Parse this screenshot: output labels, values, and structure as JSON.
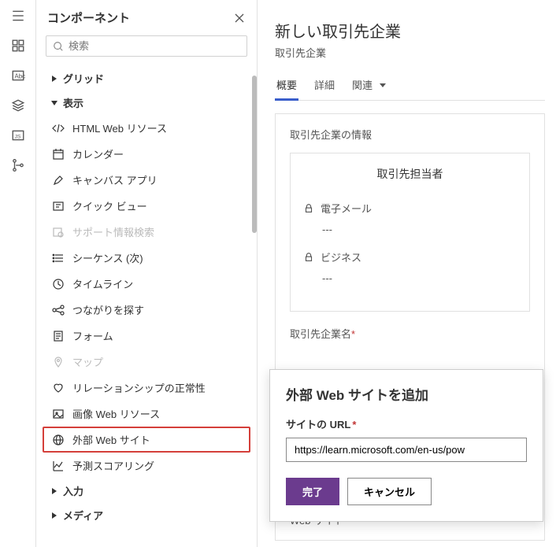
{
  "panel": {
    "title": "コンポーネント",
    "search_placeholder": "検索",
    "sections": {
      "grid": "グリッド",
      "display": "表示",
      "input": "入力",
      "media": "メディア"
    },
    "items": {
      "html_web": "HTML Web リソース",
      "calendar": "カレンダー",
      "canvas": "キャンバス アプリ",
      "quick_view": "クイック ビュー",
      "support": "サポート情報検索",
      "sequence": "シーケンス (次)",
      "timeline": "タイムライン",
      "connections": "つながりを探す",
      "form": "フォーム",
      "map": "マップ",
      "relationship": "リレーションシップの正常性",
      "image_web": "画像 Web リソース",
      "external_web": "外部 Web サイト",
      "predictive": "予測スコアリング"
    }
  },
  "main": {
    "title": "新しい取引先企業",
    "subtitle": "取引先企業",
    "tabs": {
      "overview": "概要",
      "details": "詳細",
      "related": "関連"
    },
    "section_title": "取引先企業の情報",
    "contact_title": "取引先担当者",
    "email_label": "電子メール",
    "email_value": "---",
    "business_label": "ビジネス",
    "business_value": "---",
    "company_name": "取引先企業名",
    "website": "Web サイト"
  },
  "dialog": {
    "title": "外部 Web サイトを追加",
    "url_label": "サイトの URL",
    "url_value": "https://learn.microsoft.com/en-us/pow",
    "done": "完了",
    "cancel": "キャンセル"
  }
}
